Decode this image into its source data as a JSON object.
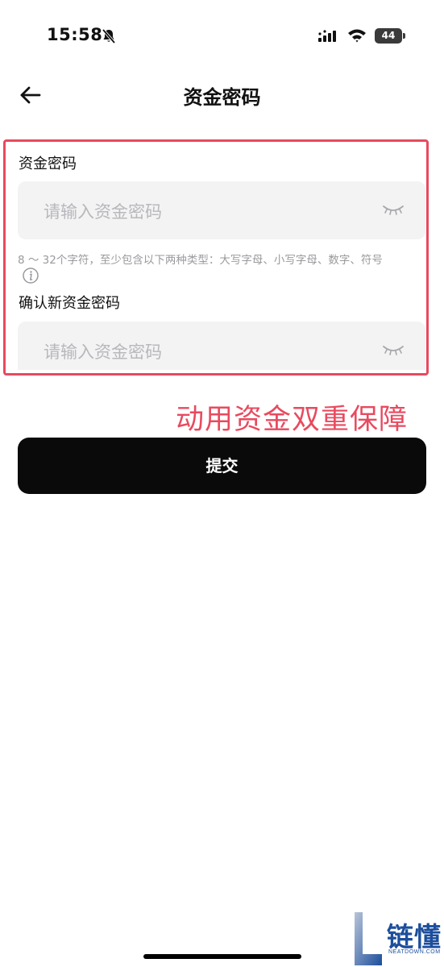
{
  "status_bar": {
    "time": "15:58",
    "battery_level": "44",
    "icons": [
      "bell-slash-icon",
      "signal-icon",
      "wifi-icon",
      "battery-icon"
    ]
  },
  "header": {
    "back_icon": "arrow-left-icon",
    "title": "资金密码"
  },
  "form": {
    "password": {
      "label": "资金密码",
      "placeholder": "请输入资金密码",
      "toggle_icon": "eye-closed-icon"
    },
    "hint": "8 ～ 32个字符，至少包含以下两种类型：大写字母、小写字母、数字、符号",
    "hint_icon": "info-icon",
    "confirm": {
      "label": "确认新资金密码",
      "placeholder": "请输入资金密码",
      "toggle_icon": "eye-closed-icon"
    }
  },
  "annotation": {
    "text": "动用资金双重保障",
    "color": "#e84a5f"
  },
  "submit": {
    "label": "提交"
  },
  "watermark": {
    "text": "链懂",
    "sub": "NEATDOWN.COM"
  },
  "colors": {
    "accent": "#e84a5f",
    "button": "#0a0a0a",
    "input_bg": "#f3f3f4"
  }
}
